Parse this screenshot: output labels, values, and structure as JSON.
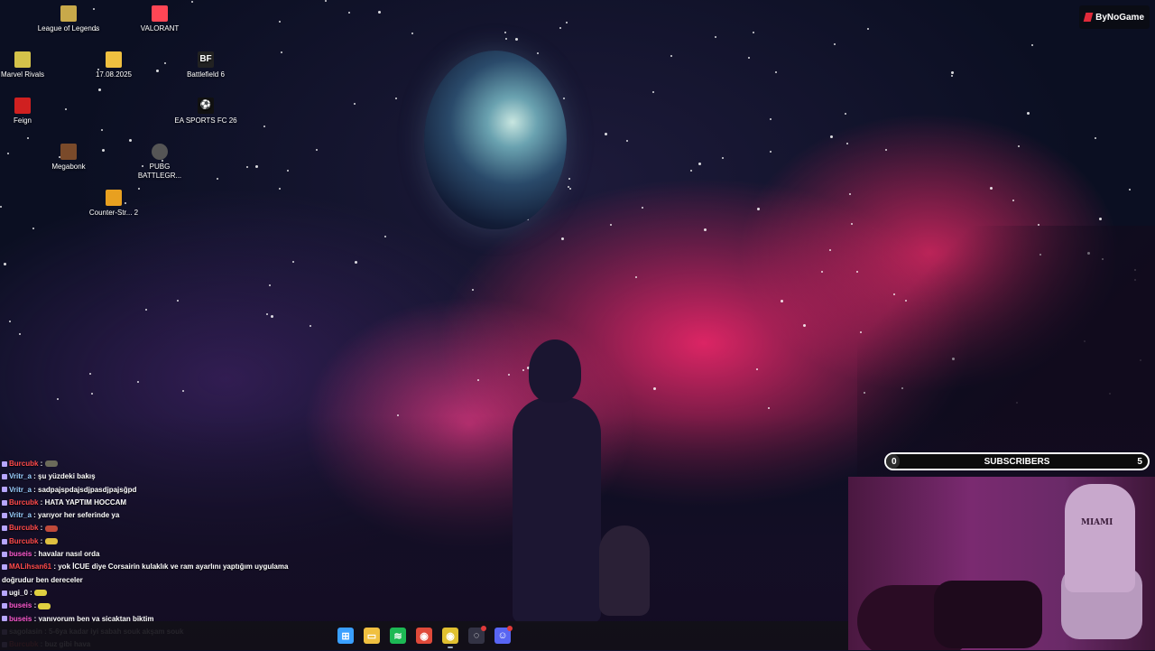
{
  "desktop_icons": [
    {
      "label": "League of Legends",
      "icon": "league-of-legends-icon",
      "color": "#c8a94a"
    },
    {
      "label": "VALORANT",
      "icon": "valorant-icon",
      "color": "#ff4655"
    },
    {
      "label": "Marvel Rivals",
      "icon": "marvel-rivals-icon",
      "color": "#d4c24a"
    },
    {
      "label": "17.08.2025",
      "icon": "folder-icon",
      "color": "#f0c040"
    },
    {
      "label": "Battlefield 6",
      "icon": "battlefield-icon",
      "color": "#222222"
    },
    {
      "label": "Feign",
      "icon": "feign-icon",
      "color": "#d02020"
    },
    {
      "label": "EA SPORTS FC 26",
      "icon": "ea-sports-fc-icon",
      "color": "#111111"
    },
    {
      "label": "Megabonk",
      "icon": "megabonk-icon",
      "color": "#7a4a2a"
    },
    {
      "label": "PUBG BATTLEGR...",
      "icon": "pubg-icon",
      "color": "#555555"
    },
    {
      "label": "Counter-Str... 2",
      "icon": "counter-strike-icon",
      "color": "#e8a020"
    }
  ],
  "brand": {
    "label": "ByNoGame",
    "color": "#e02a3a"
  },
  "subscribers": {
    "label": "SUBSCRIBERS",
    "current": "0",
    "goal": "5",
    "progress": 0.05
  },
  "chat": [
    {
      "user": "Burcubk",
      "color": "#ff4a4a",
      "text": "",
      "emote": "#6b6b5a"
    },
    {
      "user": "Vritr_a",
      "color": "#9ad0ff",
      "text": "şu yüzdeki bakış"
    },
    {
      "user": "Vritr_a",
      "color": "#9ad0ff",
      "text": "sadpajspdajsdjpasdjpajsğpd"
    },
    {
      "user": "Burcubk",
      "color": "#ff4a4a",
      "text": "HATA YAPTIM HOCCAM"
    },
    {
      "user": "Vritr_a",
      "color": "#9ad0ff",
      "text": "yarıyor her seferinde ya"
    },
    {
      "user": "Burcubk",
      "color": "#ff4a4a",
      "text": "",
      "emote": "#c04a3a"
    },
    {
      "user": "Burcubk",
      "color": "#ff4a4a",
      "text": "",
      "emote": "#e0c040"
    },
    {
      "user": "buseis",
      "color": "#ff5ad0",
      "text": "havalar nasıl orda"
    },
    {
      "user": "MALihsan61",
      "color": "#ff4a4a",
      "text": "yok İCUE diye Corsairin kulaklık ve ram ayarlını yaptığım uygulama doğrudur ben dereceler"
    },
    {
      "user": "ugi_0",
      "color": "#ffffff",
      "text": "",
      "emote": "#e0d040"
    },
    {
      "user": "buseis",
      "color": "#ff5ad0",
      "text": "",
      "emote": "#e0d040"
    },
    {
      "user": "buseis",
      "color": "#ff5ad0",
      "text": "yanıyorum ben ya sicaktan biktim"
    },
    {
      "user": "sagolasin",
      "color": "#ffffff",
      "text": "5-6ya kadar iyi sabah souk akşam souk"
    },
    {
      "user": "Burcubk",
      "color": "#ff4a4a",
      "text": "buz gibi hava"
    }
  ],
  "taskbar": [
    {
      "name": "windows-start-icon",
      "color": "#3aa0ff",
      "glyph": "⊞"
    },
    {
      "name": "file-explorer-icon",
      "color": "#f0c040",
      "glyph": "▭"
    },
    {
      "name": "spotify-icon",
      "color": "#1db954",
      "glyph": "≋"
    },
    {
      "name": "chrome-icon",
      "color": "#e04a3a",
      "glyph": "◉"
    },
    {
      "name": "chrome-active-icon",
      "color": "#e0c030",
      "glyph": "◉"
    },
    {
      "name": "obs-icon",
      "color": "#333344",
      "glyph": "◌"
    },
    {
      "name": "discord-icon",
      "color": "#5865f2",
      "glyph": "☺"
    }
  ]
}
